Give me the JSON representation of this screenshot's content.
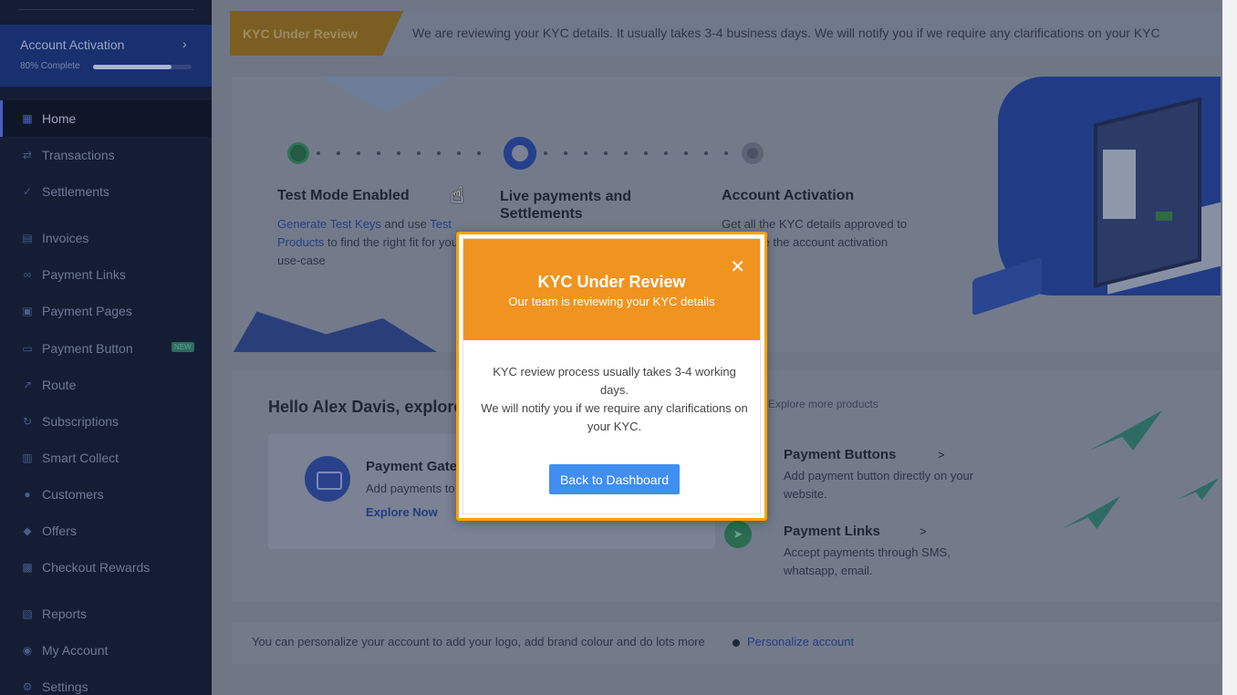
{
  "sidebar": {
    "account_activation": {
      "title": "Account Activation",
      "chevron": "›",
      "progress_label": "80% Complete",
      "progress": 0.8
    },
    "items": [
      {
        "label": "Home",
        "icon": "home-icon",
        "glyph": "▦"
      },
      {
        "label": "Transactions",
        "icon": "transactions-icon",
        "glyph": "⇄"
      },
      {
        "label": "Settlements",
        "icon": "settlements-icon",
        "glyph": "✓"
      },
      {
        "label": "Invoices",
        "icon": "invoices-icon",
        "glyph": "▤"
      },
      {
        "label": "Payment Links",
        "icon": "payment-links-icon",
        "glyph": "∞"
      },
      {
        "label": "Payment Pages",
        "icon": "payment-pages-icon",
        "glyph": "▣"
      },
      {
        "label": "Payment Button",
        "icon": "payment-button-icon",
        "glyph": "▭",
        "badge": "NEW"
      },
      {
        "label": "Route",
        "icon": "route-icon",
        "glyph": "↗"
      },
      {
        "label": "Subscriptions",
        "icon": "subscriptions-icon",
        "glyph": "↻"
      },
      {
        "label": "Smart Collect",
        "icon": "smart-collect-icon",
        "glyph": "▥"
      },
      {
        "label": "Customers",
        "icon": "customers-icon",
        "glyph": "●"
      },
      {
        "label": "Offers",
        "icon": "offers-icon",
        "glyph": "◆"
      },
      {
        "label": "Checkout Rewards",
        "icon": "checkout-rewards-icon",
        "glyph": "▩"
      },
      {
        "label": "Reports",
        "icon": "reports-icon",
        "glyph": "▧"
      },
      {
        "label": "My Account",
        "icon": "my-account-icon",
        "glyph": "◉"
      },
      {
        "label": "Settings",
        "icon": "settings-icon",
        "glyph": "⚙"
      }
    ]
  },
  "banner": {
    "tag": "KYC Under Review",
    "text": "We are reviewing your KYC details. It usually takes 3-4 business days. We will notify you if we require any clarifications on your KYC"
  },
  "steps": [
    {
      "title": "Test Mode Enabled",
      "link1": "Generate Test Keys",
      "mid": " and use ",
      "link2": "Test Products",
      "rest": " to find the right fit for your use-case"
    },
    {
      "title": "Live payments and Settlements"
    },
    {
      "title": "Account Activation",
      "desc": "Get all the KYC details approved to complete the account activation"
    }
  ],
  "explore": {
    "hello": "Hello Alex Davis, explore the products",
    "more_products": "Explore more products",
    "gateway": {
      "title": "Payment Gateway",
      "desc": "Add payments to your website",
      "link": "Explore Now"
    },
    "products": [
      {
        "title": "Payment Buttons",
        "chevron": ">",
        "desc": "Add payment button directly on your website."
      },
      {
        "title": "Payment Links",
        "chevron": ">",
        "desc": "Accept payments through SMS, whatsapp, email."
      }
    ]
  },
  "personalize": {
    "text": "You can personalize your account to add your logo, add brand colour and do lots more",
    "link": "Personalize account"
  },
  "modal": {
    "title": "KYC Under Review",
    "subtitle": "Our team is reviewing your KYC details",
    "close": "✕",
    "body_line1": "KYC review process usually takes 3-4 working days.",
    "body_line2": "We will notify you if we require any clarifications on your KYC.",
    "button": "Back to Dashboard"
  },
  "colors": {
    "sidebar_bg": "#141d33",
    "modal_header": "#f0941f",
    "modal_border": "#f5a300",
    "primary_button": "#3f8ef0"
  }
}
